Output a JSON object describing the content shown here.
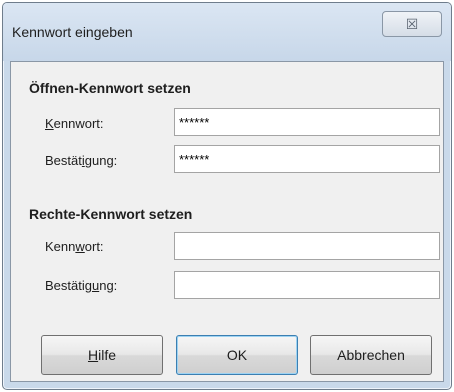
{
  "window": {
    "title": "Kennwort eingeben",
    "close_glyph": "☒"
  },
  "open_password": {
    "heading": "Öffnen-Kennwort setzen",
    "password_label_prefix": "",
    "password_label_access": "K",
    "password_label_rest": "ennwort:",
    "password_value": "******",
    "confirm_label_prefix": "Bestät",
    "confirm_label_access": "i",
    "confirm_label_rest": "gung:",
    "confirm_value": "******"
  },
  "edit_password": {
    "heading": "Rechte-Kennwort setzen",
    "password_label_prefix": "Kenn",
    "password_label_access": "w",
    "password_label_rest": "ort:",
    "password_value": "",
    "confirm_label_prefix": "Bestätig",
    "confirm_label_access": "u",
    "confirm_label_rest": "ng:",
    "confirm_value": ""
  },
  "buttons": {
    "help_access": "H",
    "help_rest": "ilfe",
    "ok": "OK",
    "cancel": "Abbrechen"
  },
  "colors": {
    "dialog_frame": "#c9d9ea",
    "client_bg": "#f0f0f0"
  }
}
